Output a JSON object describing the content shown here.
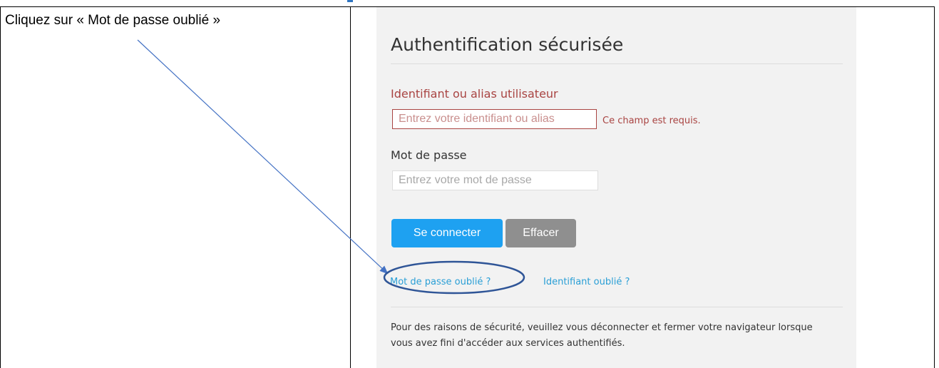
{
  "instruction": "Cliquez sur « Mot de passe oublié »",
  "login": {
    "title": "Authentification sécurisée",
    "username": {
      "label": "Identifiant ou alias utilisateur",
      "placeholder": "Entrez votre identifiant ou alias",
      "error": "Ce champ est requis."
    },
    "password": {
      "label": "Mot de passe",
      "placeholder": "Entrez votre mot de passe"
    },
    "buttons": {
      "submit": "Se connecter",
      "clear": "Effacer"
    },
    "links": {
      "forgot_password": "Mot de passe oublié ?",
      "forgot_username": "Identifiant oublié ?"
    },
    "notice": "Pour des raisons de sécurité, veuillez vous déconnecter et fermer votre navigateur lorsque vous avez fini d'accéder aux services authentifiés."
  },
  "colors": {
    "error": "#a94442",
    "primary_button": "#1ea1f1",
    "secondary_button": "#8f8f8f",
    "link": "#2a9fd6",
    "annotation": "#2f5597",
    "panel_background": "#f2f2f2"
  }
}
